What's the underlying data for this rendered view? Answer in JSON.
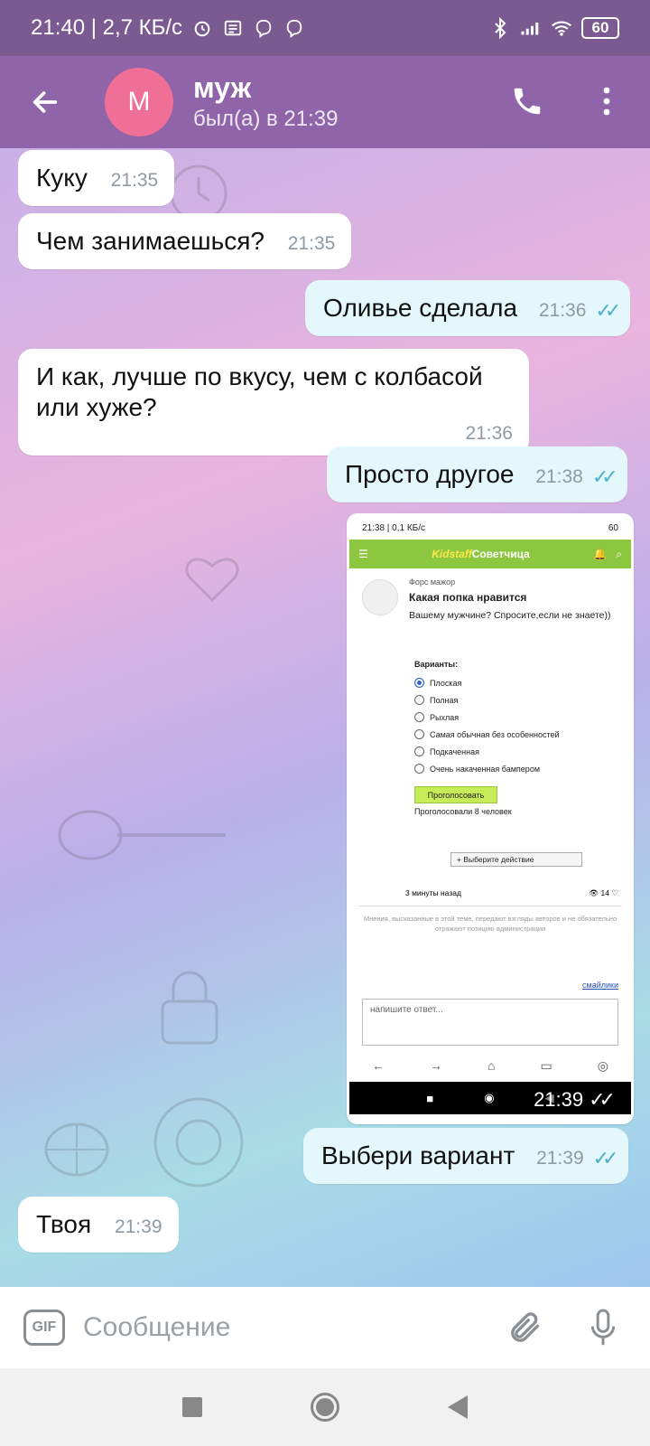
{
  "status_bar": {
    "time_speed": "21:40 | 2,7 КБ/с",
    "battery": "60"
  },
  "header": {
    "avatar_letter": "М",
    "name": "муж",
    "status": "был(а) в 21:39"
  },
  "messages": [
    {
      "text": "Куку",
      "time": "21:35",
      "direction": "in"
    },
    {
      "text": "Чем занимаешься?",
      "time": "21:35",
      "direction": "in"
    },
    {
      "text": "Оливье сделала",
      "time": "21:36",
      "direction": "out",
      "read": true
    },
    {
      "text": "И как, лучше по вкусу, чем с колбасой или хуже?",
      "time": "21:36",
      "direction": "in"
    },
    {
      "text": "Просто другое",
      "time": "21:38",
      "direction": "out",
      "read": true
    },
    {
      "text": "Выбери вариант",
      "time": "21:39",
      "direction": "out",
      "read": true
    },
    {
      "text": "Твоя",
      "time": "21:39",
      "direction": "in"
    }
  ],
  "image_message": {
    "time": "21:39",
    "screenshot": {
      "status_time": "21:38 | 0,1 КБ/с",
      "battery": "60",
      "site_logo_part1": "Kidstaff",
      "site_logo_part2": "Советчица",
      "author": "Форс мажор",
      "title": "Какая попка нравится",
      "question": "Вашему мужчине? Спросите,если не знаете))",
      "poll_header": "Варианты:",
      "poll_options": [
        "Плоская",
        "Полная",
        "Рыхлая",
        "Самая обычная без особенностей",
        "Подкаченная",
        "Очень накаченная бампером"
      ],
      "vote_button": "Проголосовать",
      "voted_count": "Проголосовали 8 человек",
      "action_select": "+ Выберите действие",
      "posted_ago": "3 минуты назад",
      "views": "14",
      "disclaimer": "Мнения, высказанные в этой теме, передают взгляды авторов и не обязательно отражают позицию администрации",
      "smiles_link": "смайлики",
      "reply_placeholder": "напишите ответ..."
    }
  },
  "input": {
    "placeholder": "Сообщение",
    "gif_label": "GIF"
  },
  "colors": {
    "header": "#9064a8",
    "status_bar": "#7a5a90",
    "avatar": "#ef6f96",
    "read_check": "#4db0c8"
  }
}
